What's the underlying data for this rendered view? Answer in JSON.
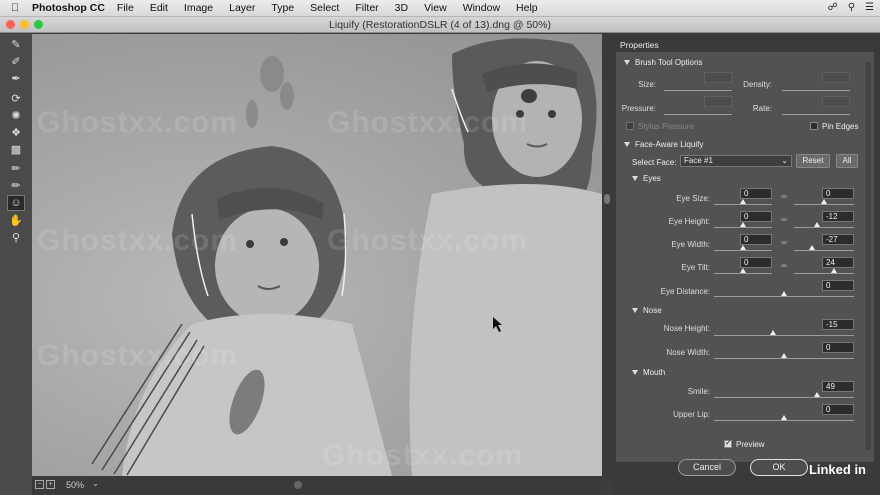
{
  "menubar": {
    "app_name": "Photoshop CC",
    "items": [
      "File",
      "Edit",
      "Image",
      "Layer",
      "Type",
      "Select",
      "Filter",
      "3D",
      "View",
      "Window",
      "Help"
    ]
  },
  "window": {
    "title": "Liquify (RestorationDSLR (4 of 13).dng @ 50%)"
  },
  "watermark": "Ghostxx.com",
  "canvas": {
    "zoom": "50%"
  },
  "panel": {
    "title": "Properties",
    "brush": {
      "header": "Brush Tool Options",
      "size_label": "Size:",
      "density_label": "Density:",
      "pressure_label": "Pressure:",
      "rate_label": "Rate:",
      "stylus_label": "Stylus Pressure",
      "pin_label": "Pin Edges"
    },
    "face": {
      "header": "Face-Aware Liquify",
      "select_label": "Select Face:",
      "selected": "Face #1",
      "reset": "Reset",
      "all": "All",
      "eyes": {
        "header": "Eyes",
        "size_label": "Eye Size:",
        "size_l": "0",
        "size_r": "0",
        "height_label": "Eye Height:",
        "height_l": "0",
        "height_r": "-12",
        "width_label": "Eye Width:",
        "width_l": "0",
        "width_r": "-27",
        "tilt_label": "Eye Tilt:",
        "tilt_l": "0",
        "tilt_r": "24",
        "distance_label": "Eye Distance:",
        "distance": "0"
      },
      "nose": {
        "header": "Nose",
        "height_label": "Nose Height:",
        "height": "-15",
        "width_label": "Nose Width:",
        "width": "0"
      },
      "mouth": {
        "header": "Mouth",
        "smile_label": "Smile:",
        "smile": "49",
        "upper_label": "Upper Lip:",
        "upper": "0"
      }
    },
    "preview_label": "Preview",
    "cancel": "Cancel",
    "ok": "OK"
  },
  "brand": "Linked in",
  "colors": {
    "panel_bg": "#525252",
    "frame_bg": "#3a3a3a"
  }
}
